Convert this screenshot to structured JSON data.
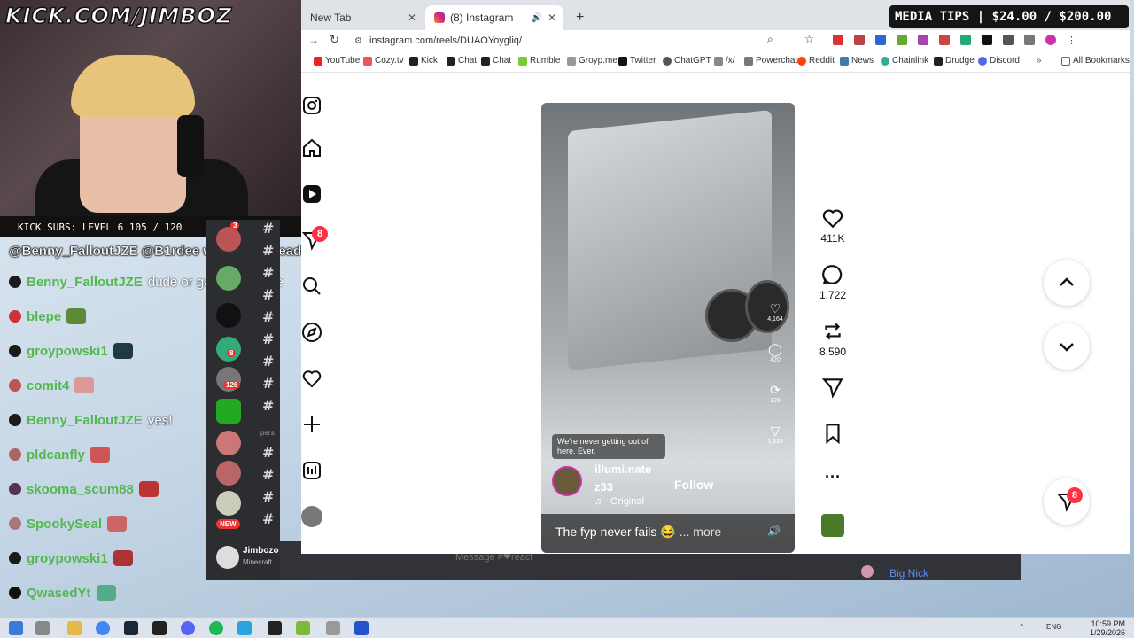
{
  "stream": {
    "banner": "KICK.COM/JIMBOZ",
    "subs": "KICK SUBS: LEVEL 6 105 / 120",
    "media_tips": "MEDIA TIPS | $24.00 / $200.00"
  },
  "chat": [
    {
      "name": "@Benny_FalloutJZE @B1rdee will give u head",
      "msg": "",
      "color": "#ffffff"
    },
    {
      "name": "Benny_FalloutJZE",
      "msg": "dude or gal I don't care",
      "color": "#3fbf3f"
    },
    {
      "name": "blepe",
      "msg": "",
      "color": "#3fbf3f"
    },
    {
      "name": "groypowski1",
      "msg": "",
      "color": "#3fbf3f"
    },
    {
      "name": "comit4",
      "msg": "",
      "color": "#3fbf3f"
    },
    {
      "name": "Benny_FalloutJZE",
      "msg": "yes!",
      "color": "#3fbf3f"
    },
    {
      "name": "pldcanfly",
      "msg": "",
      "color": "#3fbf3f"
    },
    {
      "name": "skooma_scum88",
      "msg": "",
      "color": "#3fbf3f"
    },
    {
      "name": "SpookySeal",
      "msg": "",
      "color": "#3fbf3f"
    },
    {
      "name": "groypowski1",
      "msg": "",
      "color": "#3fbf3f"
    },
    {
      "name": "QwasedYt",
      "msg": "",
      "color": "#3fbf3f"
    }
  ],
  "discord": {
    "badges": [
      "3",
      "8",
      "126",
      "1",
      "1",
      "1"
    ],
    "new_label": "NEW",
    "user": "Jimbozo",
    "status": "Minecraft",
    "section": "pers",
    "message_placeholder": "Message #❤react",
    "member": "Big Nick"
  },
  "browser": {
    "tabs": [
      {
        "label": "New Tab"
      },
      {
        "label": "(8) Instagram"
      }
    ],
    "url": "instagram.com/reels/DUAOYoygliq/",
    "bookmarks": [
      "YouTube",
      "Cozy.tv",
      "Kick",
      "Chat",
      "Chat",
      "Rumble",
      "Groyp.me",
      "Twitter",
      "ChatGPT",
      "/x/",
      "Powerchat",
      "Reddit",
      "News",
      "Chainlink",
      "Drudge",
      "Discord"
    ],
    "all_bookmarks": "All Bookmarks"
  },
  "ig": {
    "nav_badge": "8",
    "likes": "411K",
    "comments": "1,722",
    "reposts": "8,590",
    "dm_badge": "8"
  },
  "reel": {
    "overlay_text": "We're never getting out of here. Ever.",
    "username": "illumi.nate",
    "subname": "z33",
    "audio": "♫ · Original",
    "follow": "Follow",
    "caption": "The fyp never fails 😂",
    "more": "... more",
    "mini_likes": "4,164",
    "mini_comments": "420",
    "mini_reposts": "326",
    "mini_shares": "1,325"
  },
  "taskbar": {
    "lang": "ENG",
    "time": "10:59 PM",
    "date": "1/29/2026"
  }
}
